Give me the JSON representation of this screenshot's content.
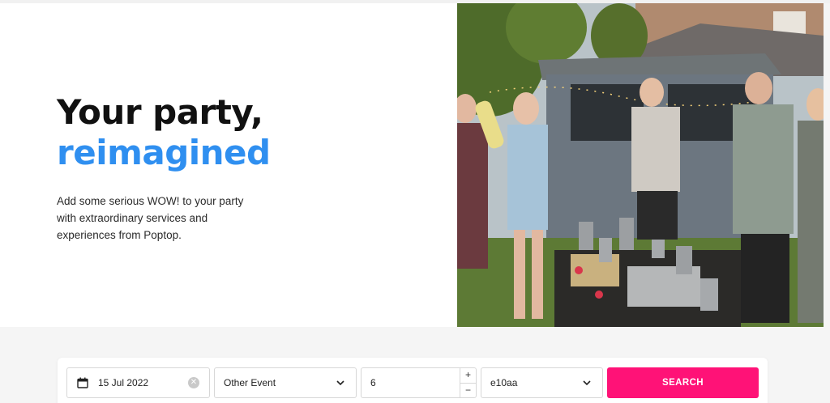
{
  "hero": {
    "title_line1": "Your party,",
    "title_line2": "reimagined",
    "subtitle": "Add some serious WOW! to your party with extraordinary services and experiences from Poptop.",
    "photo_icon": "party-photo",
    "accent_color": "#2f8ff0"
  },
  "search": {
    "date_value": "15 Jul 2022",
    "date_icon": "calendar-icon",
    "clear_icon": "clear-icon",
    "event_value": "Other Event",
    "guests_value": "6",
    "guests_plus": "+",
    "guests_minus": "−",
    "postcode_value": "e10aa",
    "button_label": "SEARCH",
    "button_color": "#ff1277"
  }
}
